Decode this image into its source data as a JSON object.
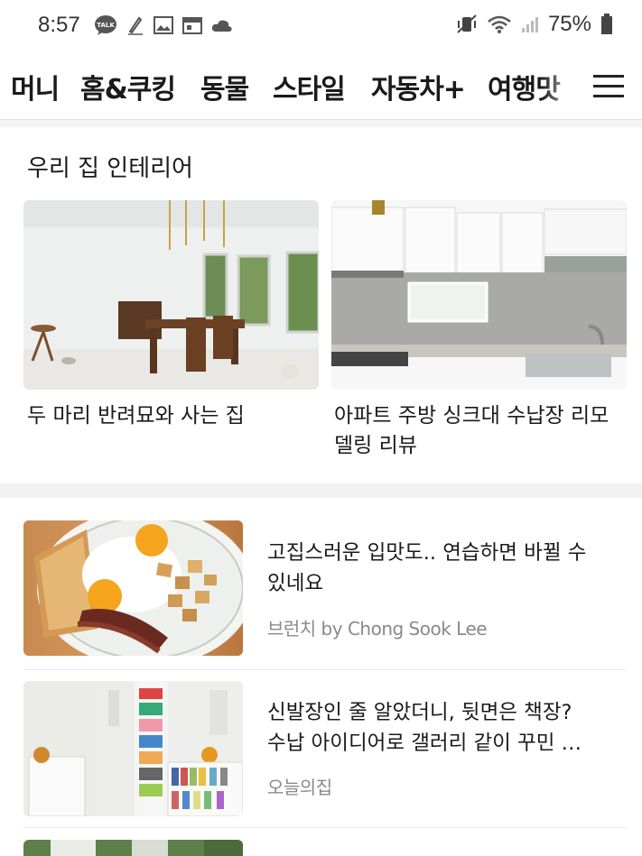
{
  "status": {
    "time": "8:57",
    "battery_pct": "75%",
    "left_icons": [
      "talk-icon",
      "pen-icon",
      "image-icon",
      "calendar-icon",
      "cloud-icon"
    ],
    "right_icons": [
      "mute-vibrate-icon",
      "wifi-icon",
      "signal-icon",
      "battery-icon"
    ]
  },
  "tabs": [
    {
      "label": "머니",
      "active": false
    },
    {
      "label": "홈&쿠킹",
      "active": true
    },
    {
      "label": "동물",
      "active": false
    },
    {
      "label": "스타일",
      "active": false
    },
    {
      "label": "자동차+",
      "active": false
    },
    {
      "label": "여행맛",
      "active": false
    }
  ],
  "interior_section": {
    "title": "우리 집 인테리어",
    "cards": [
      {
        "title": "두 마리 반려묘와 사는 집",
        "image": "living-room-photo"
      },
      {
        "title_lines": [
          "아파트 주방 싱크대 수납장 리모",
          "델링 리뷰"
        ],
        "image": "kitchen-photo"
      }
    ]
  },
  "feed": [
    {
      "title_lines": [
        "고집스러운 입맛도.. 연습하면 바뀔 수",
        "있네요"
      ],
      "source": "브런치 by Chong Sook Lee",
      "image": "breakfast-photo"
    },
    {
      "title_lines": [
        "신발장인 줄 알았더니, 뒷면은 책장?",
        "수납 아이디어로 갤러리 같이 꾸민 …"
      ],
      "source": "오늘의집",
      "image": "bookshelf-photo"
    }
  ],
  "colors": {
    "accent": "#111111",
    "divider": "#e8e8e8",
    "source_text": "#8a8a8a"
  }
}
